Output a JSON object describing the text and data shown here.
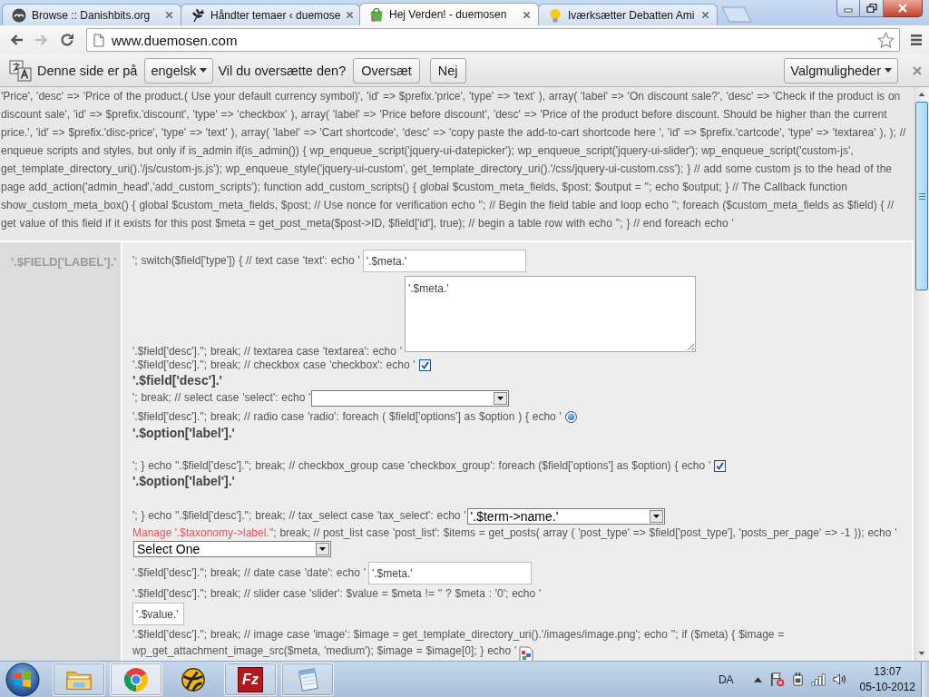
{
  "window": {
    "tabs": [
      {
        "title": "Browse :: Danishbits.org",
        "kind": "badge",
        "selected": false
      },
      {
        "title": "Håndter temaer ‹ duemose",
        "kind": "sprig",
        "selected": false
      },
      {
        "title": "Hej Verden! - duemosen",
        "kind": "bag",
        "selected": true
      },
      {
        "title": "Iværksætter Debatten Ami",
        "kind": "bulb",
        "selected": false
      }
    ]
  },
  "toolbar": {
    "buttons": [
      {
        "kind": "back",
        "disabled": false
      },
      {
        "kind": "forward",
        "disabled": true
      },
      {
        "kind": "reload",
        "disabled": false
      }
    ],
    "address": "www.duemosen.com"
  },
  "translate_bar": {
    "prompt": "Denne side er på",
    "language": "engelsk",
    "question": "Vil du oversætte den?",
    "buttons": [
      "Oversæt",
      "Nej"
    ],
    "options_menu": "Valgmuligheder"
  },
  "page": {
    "code_text": "'Price', 'desc' => 'Price of the product.( Use your default currency symbol)', 'id' => $prefix.'price', 'type' => 'text' ), array( 'label' => 'On discount sale?', 'desc' => 'Check if the product is on discount sale', 'id' => $prefix.'discount', 'type' => 'checkbox' ), array( 'label' => 'Price before discount', 'desc' => 'Price of the product before discount. Should be higher than the current price.', 'id' => $prefix.'disc-price', 'type' => 'text' ), array( 'label' => 'Cart shortcode', 'desc' => 'copy paste the add-to-cart shortcode here ', 'id' => $prefix.'cartcode', 'type' => 'textarea' ), ); // enqueue scripts and styles, but only if is_admin if(is_admin()) { wp_enqueue_script('jquery-ui-datepicker'); wp_enqueue_script('jquery-ui-slider'); wp_enqueue_script('custom-js', get_template_directory_uri().'/js/custom-js.js'); wp_enqueue_style('jquery-ui-custom', get_template_directory_uri().'/css/jquery-ui-custom.css'); } // add some custom js to the head of the page add_action('admin_head','add_custom_scripts'); function add_custom_scripts() { global $custom_meta_fields, $post; $output = ''; echo $output; } // The Callback function show_custom_meta_box() { global $custom_meta_fields, $post; // Use nonce for verification echo ''; // Begin the field table and loop echo ''; foreach ($custom_meta_fields as $field) { // get value of this field if it exists for this post $meta = get_post_meta($post->ID, $field['id'], true); // begin a table row with echo ''; } // end foreach echo '",
    "field_table": {
      "label": "'.$FIELD['LABEL'].'",
      "rows": [
        {
          "kind": "line",
          "text": "'; switch($field['type']) { // text case 'text': echo '",
          "control": {
            "kind": "input",
            "value": "'.$meta.'"
          }
        },
        {
          "kind": "line",
          "text": "'.$field['desc'].''; break; // textarea case 'textarea': echo '",
          "control": {
            "kind": "textarea",
            "value": "'.$meta.'"
          }
        },
        {
          "kind": "line",
          "text": "'.$field['desc'].''; break; // checkbox case 'checkbox': echo '",
          "control": {
            "kind": "checkbox",
            "checked": true
          }
        },
        {
          "kind": "label",
          "text": "'.$field['desc'].'"
        },
        {
          "kind": "line",
          "text": "'; break; // select case 'select': echo '",
          "control": {
            "kind": "select"
          }
        },
        {
          "kind": "option",
          "text": "'.$field['desc'].''; break; // radio case 'radio': foreach ( $field['options'] as $option ) { echo '",
          "control": {
            "kind": "radio",
            "selected": true
          },
          "label": "'.$option['label'].'"
        },
        {
          "kind": "option",
          "text": "'; } echo ''.$field['desc'].''; break; // checkbox_group case 'checkbox_group': foreach ($field['options'] as $option) { echo '",
          "control": {
            "kind": "checkbox",
            "checked": true
          },
          "label": "'.$option['label'].'"
        },
        {
          "kind": "line",
          "text": "'; } echo ''.$field['desc'].''; break; // tax_select case 'tax_select': echo '",
          "control": {
            "kind": "select",
            "value": "'.$term->name.'"
          }
        },
        {
          "kind": "line",
          "link": "Manage '.$taxonomy->label.'",
          "text": "'; break; // post_list case 'post_list': $items = get_posts( array ( 'post_type' => $field['post_type'], 'posts_per_page' => -1 )); echo '"
        },
        {
          "kind": "line",
          "control": {
            "kind": "select",
            "value": "Select One"
          }
        },
        {
          "kind": "line",
          "text": "'.$field['desc'].''; break; // date case 'date': echo '",
          "control": {
            "kind": "input",
            "value": "'.$meta.'"
          }
        },
        {
          "kind": "line",
          "text": "'.$field['desc'].''; break; // slider case 'slider': $value = $meta != '' ? $meta : '0'; echo '"
        },
        {
          "kind": "line",
          "control": {
            "kind": "short_input",
            "value": "'.$value.'"
          }
        },
        {
          "kind": "line",
          "text": "'.$field['desc'].''; break; // image case 'image': $image = get_template_directory_uri().'/images/image.png'; echo ''; if ($meta) { $image ="
        },
        {
          "kind": "line",
          "text": "wp_get_attachment_image_src($meta, 'medium'); $image = $image[0]; } echo '",
          "control": {
            "kind": "image"
          }
        }
      ]
    }
  },
  "taskbar": {
    "apps": [
      {
        "kind": "folder",
        "running": true,
        "selected": false
      },
      {
        "kind": "browser",
        "running": true,
        "selected": true
      },
      {
        "kind": "ball",
        "running": false,
        "selected": false
      },
      {
        "kind": "ftp",
        "logo_text": "Fz",
        "running": true,
        "selected": false
      },
      {
        "kind": "notepad",
        "running": true,
        "selected": false
      }
    ],
    "tray": {
      "language": "DA",
      "time": "13:07",
      "date": "05-10-2012"
    }
  }
}
